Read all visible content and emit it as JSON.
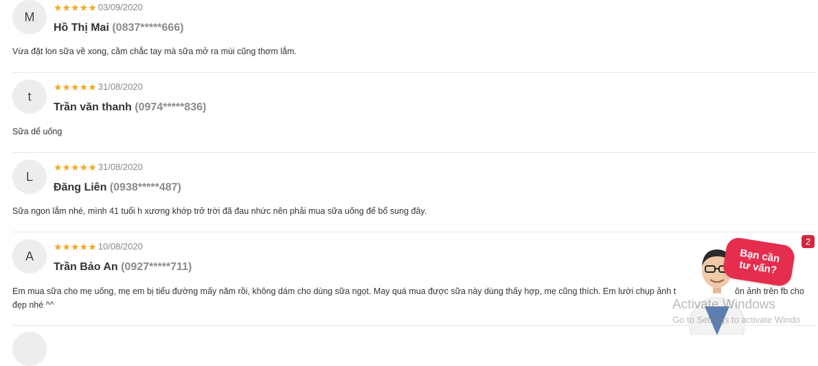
{
  "reviews": [
    {
      "initial": "M",
      "stars": "★★★★★",
      "date": "03/09/2020",
      "name": "Hồ Thị Mai",
      "phone": "(0837*****666)",
      "content": "Vừa đặt lon sữa về xong, cầm chắc tay mà sữa mở ra mùi cũng thơm lắm."
    },
    {
      "initial": "t",
      "stars": "★★★★★",
      "date": "31/08/2020",
      "name": "Trần văn thanh",
      "phone": "(0974*****836)",
      "content": "Sữa dể uống"
    },
    {
      "initial": "L",
      "stars": "★★★★★",
      "date": "31/08/2020",
      "name": "Đăng Liên",
      "phone": "(0938*****487)",
      "content": "Sữa ngon lắm nhé, mình 41 tuổi h xương khớp trở trời đã đau nhức nên phải mua sữa uống để bổ sung đây."
    },
    {
      "initial": "A",
      "stars": "★★★★★",
      "date": "10/08/2020",
      "name": "Trần Bảo An",
      "phone": "(0927*****711)",
      "content_line1": "Em mua sữa cho mẹ uống, mẹ em bị tiểu đường mấy năm rồi, không dám cho dùng sữa ngọt. May quá mua được sữa này dùng thấy hợp, mẹ cũng thích. Em lười chụp ảnh t",
      "content_tail": "ôn ảnh trên fb cho",
      "content_line2": "đẹp nhé ^^"
    }
  ],
  "rating_value": 5,
  "chat": {
    "line1": "Bạn cần",
    "line2": "tư vấn?",
    "badge": "2"
  },
  "watermark": {
    "title": "Activate Windows",
    "subtitle": "Go to Settings to activate Windo"
  },
  "colors": {
    "star": "#f5a623",
    "bubble": "#e52d4e",
    "badge": "#d0283f"
  }
}
